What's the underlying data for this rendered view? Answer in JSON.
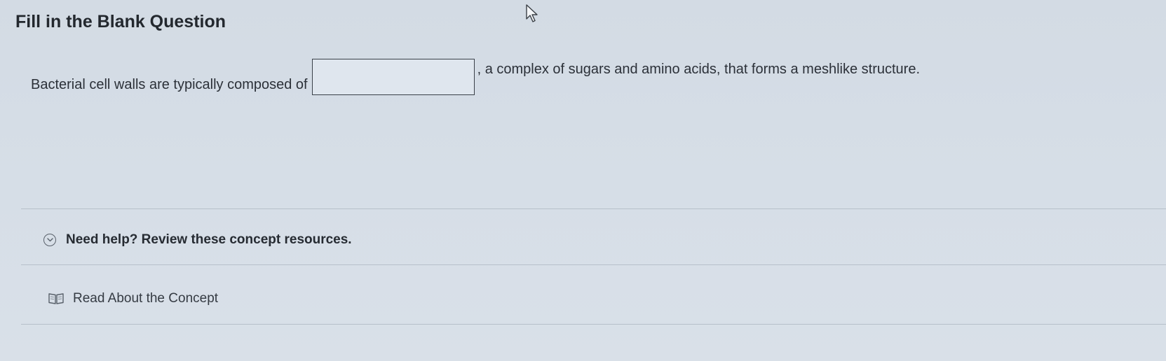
{
  "question": {
    "title": "Fill in the Blank Question",
    "text_before": "Bacterial cell walls are typically composed of",
    "blank_value": "",
    "text_after": ", a complex of sugars and amino acids, that forms a meshlike structure."
  },
  "help": {
    "toggle_label": "Need help? Review these concept resources.",
    "toggle_icon": "chevron-down-icon"
  },
  "resources": [
    {
      "label": "Read About the Concept",
      "icon": "book-icon"
    }
  ],
  "colors": {
    "background": "#d6dee7",
    "text": "#2a2f36",
    "divider": "#b7c0ca"
  }
}
